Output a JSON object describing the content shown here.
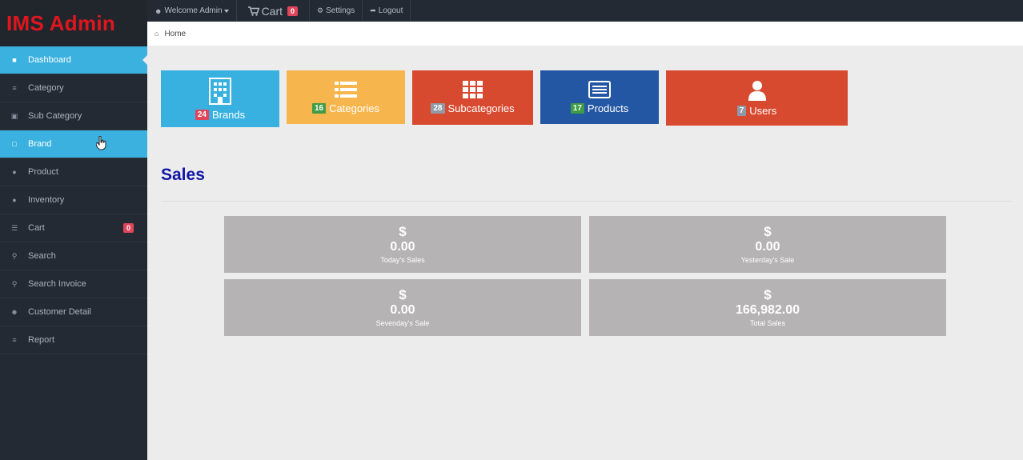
{
  "app": {
    "title": "IMS Admin"
  },
  "topbar": {
    "welcome": "Welcome Admin",
    "cart_label": "Cart",
    "cart_count": "0",
    "settings": "Settings",
    "logout": "Logout"
  },
  "breadcrumb": {
    "home": "Home"
  },
  "sidebar": {
    "items": [
      {
        "label": "Dashboard",
        "icon": "dashboard-icon"
      },
      {
        "label": "Category",
        "icon": "list-icon"
      },
      {
        "label": "Sub Category",
        "icon": "inbox-icon"
      },
      {
        "label": "Brand",
        "icon": "file-icon"
      },
      {
        "label": "Product",
        "icon": "info-icon"
      },
      {
        "label": "Inventory",
        "icon": "info-icon"
      },
      {
        "label": "Cart",
        "icon": "cart-icon",
        "badge": "0"
      },
      {
        "label": "Search",
        "icon": "search-icon"
      },
      {
        "label": "Search Invoice",
        "icon": "search-icon"
      },
      {
        "label": "Customer Detail",
        "icon": "users-icon"
      },
      {
        "label": "Report",
        "icon": "list-icon"
      }
    ]
  },
  "tiles": [
    {
      "count": "24",
      "label": "Brands",
      "color": "#38b1e0",
      "badge_color": "#e0455a",
      "icon": "building-icon"
    },
    {
      "count": "16",
      "label": "Categories",
      "color": "#f7b64d",
      "badge_color": "#3f9b45",
      "icon": "list-icon"
    },
    {
      "count": "28",
      "label": "Subcategories",
      "color": "#d84a30",
      "badge_color": "#8f9aa6",
      "icon": "grid-icon"
    },
    {
      "count": "17",
      "label": "Products",
      "color": "#2457a3",
      "badge_color": "#3f9b45",
      "icon": "card-icon"
    },
    {
      "count": "7",
      "label": "Users",
      "color": "#d84a30",
      "badge_color": "#8f9aa6",
      "icon": "user-icon"
    }
  ],
  "sales": {
    "title": "Sales",
    "currency": "$",
    "cards": [
      {
        "amount": "0.00",
        "label": "Today's Sales"
      },
      {
        "amount": "0.00",
        "label": "Yesterday's Sale"
      },
      {
        "amount": "0.00",
        "label": "Sevenday's Sale"
      },
      {
        "amount": "166,982.00",
        "label": "Total Sales"
      }
    ]
  }
}
